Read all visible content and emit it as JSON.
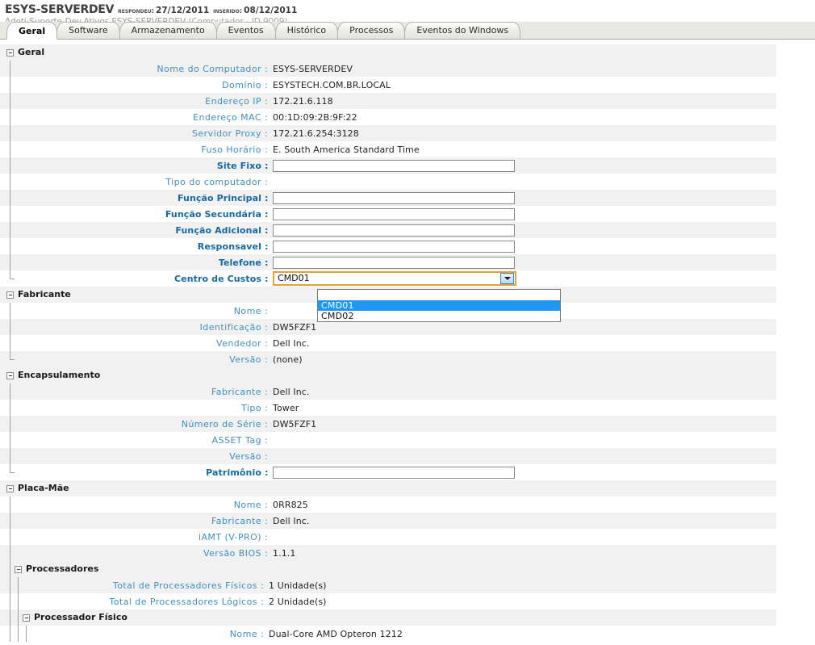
{
  "header": {
    "title": "ESYS-SERVERDEV",
    "responded_label": "Respondeu:",
    "responded_value": "27/12/2011",
    "inserted_label": "Inserido:",
    "inserted_value": "08/12/2011",
    "breadcrumb": "Adoti-Suporte-Dev.Ativos.ESYS-SERVERDEV",
    "breadcrumb_meta": "(Computador - ID 9009)"
  },
  "tabs": [
    {
      "label": "Geral",
      "active": true
    },
    {
      "label": "Software",
      "active": false
    },
    {
      "label": "Armazenamento",
      "active": false
    },
    {
      "label": "Eventos",
      "active": false
    },
    {
      "label": "Histórico",
      "active": false
    },
    {
      "label": "Processos",
      "active": false
    },
    {
      "label": "Eventos do Windows",
      "active": false
    }
  ],
  "groups": {
    "geral": "Geral",
    "fabricante": "Fabricante",
    "encapsulamento": "Encapsulamento",
    "placa_mae": "Placa-Mãe",
    "processadores": "Processadores",
    "processador_fisico": "Processador Físico"
  },
  "rows": {
    "nome_computador": {
      "label": "Nome do Computador",
      "value": "ESYS-SERVERDEV"
    },
    "dominio": {
      "label": "Domínio",
      "value": "ESYSTECH.COM.BR.LOCAL"
    },
    "endereco_ip": {
      "label": "Endereço IP",
      "value": "172.21.6.118"
    },
    "endereco_mac": {
      "label": "Endereço MAC",
      "value": "00:1D:09:2B:9F:22"
    },
    "servidor_proxy": {
      "label": "Servidor Proxy",
      "value": "172.21.6.254:3128"
    },
    "fuso_horario": {
      "label": "Fuso Horário",
      "value": "E. South America Standard Time"
    },
    "site_fixo": {
      "label": "Site Fixo",
      "value": ""
    },
    "tipo_computador": {
      "label": "Tipo do computador",
      "value": ""
    },
    "funcao_principal": {
      "label": "Função Principal",
      "value": ""
    },
    "funcao_secundaria": {
      "label": "Função Secundária",
      "value": ""
    },
    "funcao_adicional": {
      "label": "Função Adicional",
      "value": ""
    },
    "responsavel": {
      "label": "Responsavel",
      "value": ""
    },
    "telefone": {
      "label": "Telefone",
      "value": ""
    },
    "centro_custos": {
      "label": "Centro de Custos",
      "value": "CMD01"
    },
    "fab_nome": {
      "label": "Nome",
      "value": ""
    },
    "fab_identificacao": {
      "label": "Identificação",
      "value": "DW5FZF1"
    },
    "fab_vendedor": {
      "label": "Vendedor",
      "value": "Dell Inc."
    },
    "fab_versao": {
      "label": "Versão",
      "value": "(none)"
    },
    "enc_fabricante": {
      "label": "Fabricante",
      "value": "Dell Inc."
    },
    "enc_tipo": {
      "label": "Tipo",
      "value": "Tower"
    },
    "enc_numero_serie": {
      "label": "Número de Série",
      "value": "DW5FZF1"
    },
    "enc_asset_tag": {
      "label": "ASSET Tag",
      "value": ""
    },
    "enc_versao": {
      "label": "Versão",
      "value": ""
    },
    "enc_patrimonio": {
      "label": "Patrimônio",
      "value": ""
    },
    "pm_nome": {
      "label": "Nome",
      "value": "0RR825"
    },
    "pm_fabricante": {
      "label": "Fabricante",
      "value": "Dell Inc."
    },
    "pm_iamt": {
      "label": "iAMT (V-PRO)",
      "value": ""
    },
    "pm_versao_bios": {
      "label": "Versão BIOS",
      "value": "1.1.1"
    },
    "proc_total_fisicos": {
      "label": "Total de Processadores Físicos",
      "value": "1 Unidade(s)"
    },
    "proc_total_logicos": {
      "label": "Total de Processadores Lógicos",
      "value": "2 Unidade(s)"
    },
    "pf_nome": {
      "label": "Nome",
      "value": "Dual-Core AMD Opteron 1212"
    }
  },
  "dropdown": {
    "options": [
      "",
      "CMD01",
      "CMD02"
    ],
    "selected_index": 1
  },
  "colors": {
    "label_readonly": "#3f8fc0",
    "label_editable": "#1569a8",
    "row_alt": "#f1f1f1",
    "highlight": "#2196f3",
    "focus_border": "#e0a33c"
  }
}
